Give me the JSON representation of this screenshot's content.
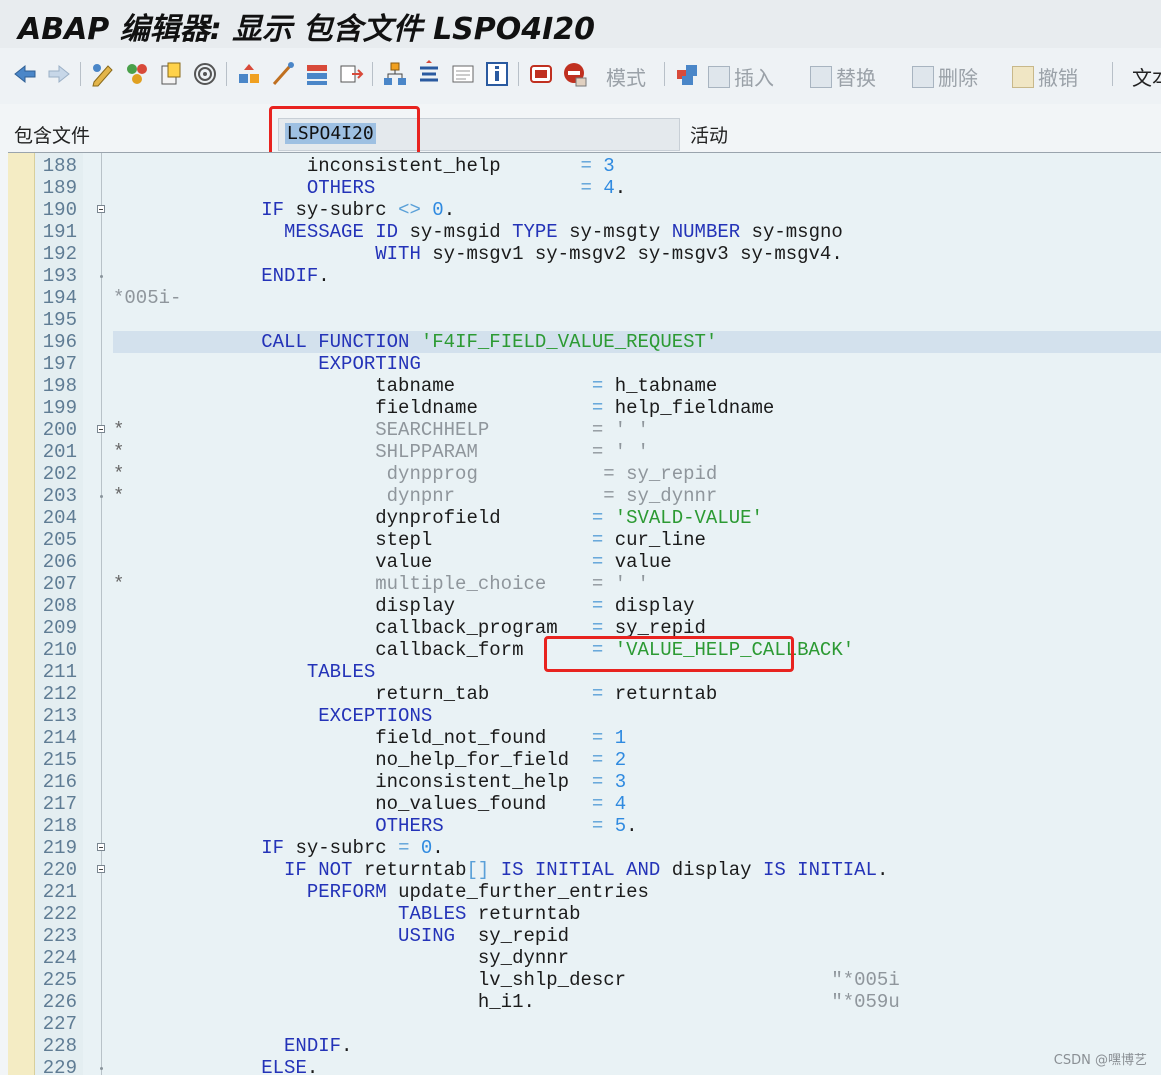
{
  "window": {
    "title": "ABAP 编辑器: 显示 包含文件 LSPO4I20"
  },
  "toolbar": {
    "icons": [
      "back-arrow-icon",
      "forward-arrow-icon",
      "edit-toggle-icon",
      "other-object-icon",
      "activate-icon",
      "syntax-check-icon",
      "where-used-icon",
      "object-list-icon",
      "navigation-icon",
      "display-object-list-icon",
      "hierarchy-icon",
      "enhance-icon",
      "breakpoint-icon",
      "help-icon",
      "debug-icon",
      "stop-icon"
    ],
    "mode_label": "模式",
    "insert_label": "插入",
    "replace_label": "替换",
    "delete_label": "删除",
    "undo_label": "撤销",
    "text_label": "文本"
  },
  "include": {
    "label": "包含文件",
    "value": "LSPO4I20",
    "status": "活动"
  },
  "code_lines": [
    {
      "n": "188",
      "segs": [
        [
          "                 inconsistent_help       ",
          "t"
        ],
        [
          "=",
          "op"
        ],
        [
          " ",
          "t"
        ],
        [
          "3",
          "num"
        ]
      ]
    },
    {
      "n": "189",
      "segs": [
        [
          "                 ",
          "t"
        ],
        [
          "OTHERS",
          "kw"
        ],
        [
          "                  ",
          "t"
        ],
        [
          "=",
          "op"
        ],
        [
          " ",
          "t"
        ],
        [
          "4",
          "num"
        ],
        [
          ".",
          "t"
        ]
      ]
    },
    {
      "n": "190",
      "segs": [
        [
          "             ",
          "t"
        ],
        [
          "IF",
          "kw"
        ],
        [
          " sy-subrc ",
          "t"
        ],
        [
          "<>",
          "op"
        ],
        [
          " ",
          "t"
        ],
        [
          "0",
          "num"
        ],
        [
          ".",
          "t"
        ]
      ]
    },
    {
      "n": "191",
      "segs": [
        [
          "               ",
          "t"
        ],
        [
          "MESSAGE ID",
          "kw"
        ],
        [
          " sy-msgid ",
          "t"
        ],
        [
          "TYPE",
          "kw"
        ],
        [
          " sy-msgty ",
          "t"
        ],
        [
          "NUMBER",
          "kw"
        ],
        [
          " sy-msgno",
          "t"
        ]
      ]
    },
    {
      "n": "192",
      "segs": [
        [
          "                       ",
          "t"
        ],
        [
          "WITH",
          "kw"
        ],
        [
          " sy-msgv1 sy-msgv2 sy-msgv3 sy-msgv4.",
          "t"
        ]
      ]
    },
    {
      "n": "193",
      "segs": [
        [
          "             ",
          "t"
        ],
        [
          "ENDIF",
          "kw"
        ],
        [
          ".",
          "t"
        ]
      ]
    },
    {
      "n": "194",
      "segs": [
        [
          "*005i-",
          "cmt"
        ]
      ]
    },
    {
      "n": "195",
      "segs": [
        [
          "",
          "t"
        ]
      ]
    },
    {
      "n": "196",
      "segs": [
        [
          "             ",
          "t"
        ],
        [
          "CALL FUNCTION",
          "kw"
        ],
        [
          " ",
          "t"
        ],
        [
          "'F4IF_FIELD_VALUE_REQUEST'",
          "str"
        ]
      ]
    },
    {
      "n": "197",
      "segs": [
        [
          "                  ",
          "t"
        ],
        [
          "EXPORTING",
          "kw"
        ]
      ]
    },
    {
      "n": "198",
      "segs": [
        [
          "                       tabname            ",
          "t"
        ],
        [
          "=",
          "op"
        ],
        [
          " h_tabname",
          "t"
        ]
      ]
    },
    {
      "n": "199",
      "segs": [
        [
          "                       fieldname          ",
          "t"
        ],
        [
          "=",
          "op"
        ],
        [
          " help_fieldname",
          "t"
        ]
      ]
    },
    {
      "n": "200",
      "segs": [
        [
          "*",
          "cmtstar"
        ],
        [
          "                      SEARCHHELP         = ' '",
          "cmt"
        ]
      ]
    },
    {
      "n": "201",
      "segs": [
        [
          "*",
          "cmtstar"
        ],
        [
          "                      SHLPPARAM          = ' '",
          "cmt"
        ]
      ]
    },
    {
      "n": "202",
      "segs": [
        [
          "*",
          "cmtstar"
        ],
        [
          "                       dynpprog           = sy_repid",
          "cmt"
        ]
      ]
    },
    {
      "n": "203",
      "segs": [
        [
          "*",
          "cmtstar"
        ],
        [
          "                       dynpnr             = sy_dynnr",
          "cmt"
        ]
      ]
    },
    {
      "n": "204",
      "segs": [
        [
          "                       dynprofield        ",
          "t"
        ],
        [
          "=",
          "op"
        ],
        [
          " ",
          "t"
        ],
        [
          "'SVALD-VALUE'",
          "str"
        ]
      ]
    },
    {
      "n": "205",
      "segs": [
        [
          "                       stepl              ",
          "t"
        ],
        [
          "=",
          "op"
        ],
        [
          " cur_line",
          "t"
        ]
      ]
    },
    {
      "n": "206",
      "segs": [
        [
          "                       value              ",
          "t"
        ],
        [
          "=",
          "op"
        ],
        [
          " value",
          "t"
        ]
      ]
    },
    {
      "n": "207",
      "segs": [
        [
          "*",
          "cmtstar"
        ],
        [
          "                      multiple_choice    = ' '",
          "cmt"
        ]
      ]
    },
    {
      "n": "208",
      "segs": [
        [
          "                       display            ",
          "t"
        ],
        [
          "=",
          "op"
        ],
        [
          " display",
          "t"
        ]
      ]
    },
    {
      "n": "209",
      "segs": [
        [
          "                       callback_program   ",
          "t"
        ],
        [
          "=",
          "op"
        ],
        [
          " sy_repid",
          "t"
        ]
      ]
    },
    {
      "n": "210",
      "segs": [
        [
          "                       callback_form      ",
          "t"
        ],
        [
          "=",
          "op"
        ],
        [
          " ",
          "t"
        ],
        [
          "'VALUE_HELP_CALLBACK'",
          "str"
        ]
      ]
    },
    {
      "n": "211",
      "segs": [
        [
          "                 ",
          "t"
        ],
        [
          "TABLES",
          "kw"
        ]
      ]
    },
    {
      "n": "212",
      "segs": [
        [
          "                       return_tab         ",
          "t"
        ],
        [
          "=",
          "op"
        ],
        [
          " returntab",
          "t"
        ]
      ]
    },
    {
      "n": "213",
      "segs": [
        [
          "                  ",
          "t"
        ],
        [
          "EXCEPTIONS",
          "kw"
        ]
      ]
    },
    {
      "n": "214",
      "segs": [
        [
          "                       field_not_found    ",
          "t"
        ],
        [
          "=",
          "op"
        ],
        [
          " ",
          "t"
        ],
        [
          "1",
          "num"
        ]
      ]
    },
    {
      "n": "215",
      "segs": [
        [
          "                       no_help_for_field  ",
          "t"
        ],
        [
          "=",
          "op"
        ],
        [
          " ",
          "t"
        ],
        [
          "2",
          "num"
        ]
      ]
    },
    {
      "n": "216",
      "segs": [
        [
          "                       inconsistent_help  ",
          "t"
        ],
        [
          "=",
          "op"
        ],
        [
          " ",
          "t"
        ],
        [
          "3",
          "num"
        ]
      ]
    },
    {
      "n": "217",
      "segs": [
        [
          "                       no_values_found    ",
          "t"
        ],
        [
          "=",
          "op"
        ],
        [
          " ",
          "t"
        ],
        [
          "4",
          "num"
        ]
      ]
    },
    {
      "n": "218",
      "segs": [
        [
          "                       ",
          "t"
        ],
        [
          "OTHERS",
          "kw"
        ],
        [
          "             ",
          "t"
        ],
        [
          "=",
          "op"
        ],
        [
          " ",
          "t"
        ],
        [
          "5",
          "num"
        ],
        [
          ".",
          "t"
        ]
      ]
    },
    {
      "n": "219",
      "segs": [
        [
          "             ",
          "t"
        ],
        [
          "IF",
          "kw"
        ],
        [
          " sy-subrc ",
          "t"
        ],
        [
          "=",
          "op"
        ],
        [
          " ",
          "t"
        ],
        [
          "0",
          "num"
        ],
        [
          ".",
          "t"
        ]
      ]
    },
    {
      "n": "220",
      "segs": [
        [
          "               ",
          "t"
        ],
        [
          "IF NOT",
          "kw"
        ],
        [
          " returntab",
          "t"
        ],
        [
          "[]",
          "op"
        ],
        [
          " ",
          "t"
        ],
        [
          "IS INITIAL AND",
          "kw"
        ],
        [
          " display ",
          "t"
        ],
        [
          "IS INITIAL",
          "kw"
        ],
        [
          ".",
          "t"
        ]
      ]
    },
    {
      "n": "221",
      "segs": [
        [
          "                 ",
          "t"
        ],
        [
          "PERFORM",
          "kw"
        ],
        [
          " update_further_entries",
          "t"
        ]
      ]
    },
    {
      "n": "222",
      "segs": [
        [
          "                         ",
          "t"
        ],
        [
          "TABLES",
          "kw"
        ],
        [
          " returntab",
          "t"
        ]
      ]
    },
    {
      "n": "223",
      "segs": [
        [
          "                         ",
          "t"
        ],
        [
          "USING",
          "kw"
        ],
        [
          "  sy_repid",
          "t"
        ]
      ]
    },
    {
      "n": "224",
      "segs": [
        [
          "                                sy_dynnr",
          "t"
        ]
      ]
    },
    {
      "n": "225",
      "segs": [
        [
          "                                lv_shlp_descr                  ",
          "t"
        ],
        [
          "\"*005i",
          "cmt"
        ]
      ]
    },
    {
      "n": "226",
      "segs": [
        [
          "                                h_i1.                          ",
          "t"
        ],
        [
          "\"*059u",
          "cmt"
        ]
      ]
    },
    {
      "n": "227",
      "segs": [
        [
          "",
          "t"
        ]
      ]
    },
    {
      "n": "228",
      "segs": [
        [
          "               ",
          "t"
        ],
        [
          "ENDIF",
          "kw"
        ],
        [
          ".",
          "t"
        ]
      ]
    },
    {
      "n": "229",
      "segs": [
        [
          "             ",
          "t"
        ],
        [
          "ELSE",
          "kw"
        ],
        [
          ".",
          "t"
        ]
      ]
    }
  ],
  "watermark": "CSDN @嘿博艺"
}
